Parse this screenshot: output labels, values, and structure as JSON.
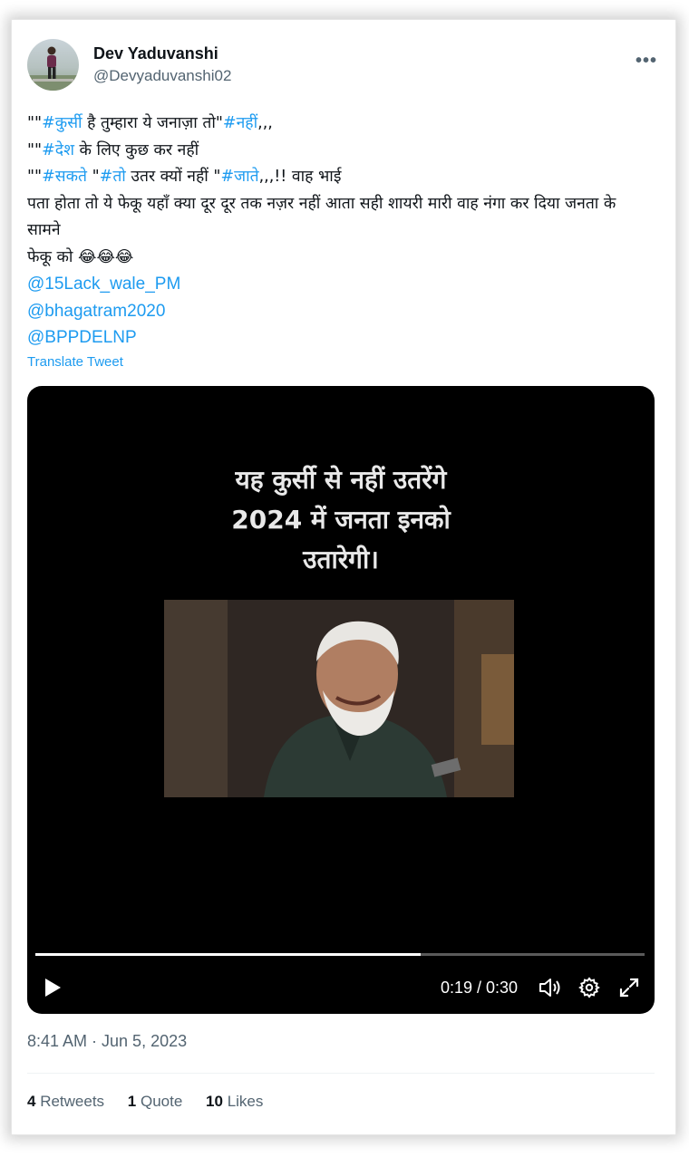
{
  "author": {
    "name": "Dev Yaduvanshi",
    "handle": "@Devyaduvanshi02"
  },
  "tweet": {
    "line1": {
      "q": "\"\"",
      "ht1": "#कुर्सी",
      "mid": " है तुम्हारा ये जनाज़ा तो\"",
      "ht2": "#नहीं",
      "end": ",,,"
    },
    "line2": {
      "q": "\"\"",
      "ht1": "#देश",
      "end": " के लिए कुछ कर नहीं"
    },
    "line3": {
      "q": "\"\"",
      "ht1": "#सकते",
      "mid": " \"",
      "ht2": "#तो",
      "mid2": " उतर क्यों नहीं \"",
      "ht3": "#जाते",
      "end": ",,,!! वाह भाई"
    },
    "line4": "पता होता तो ये फेकू यहाँ क्या दूर दूर तक नज़र नहीं आता सही शायरी मारी वाह नंगा कर दिया जनता के सामने",
    "line5": "फेकू को 😂😂😂",
    "mentions": [
      "@15Lack_wale_PM",
      "@bhagatram2020",
      "@BPPDELNP"
    ],
    "translate_label": "Translate Tweet"
  },
  "video": {
    "caption_lines": [
      "यह कुर्सी से नहीं उतरेंगे",
      "2024 में जनता इनको",
      "उतारेगी।"
    ],
    "time_display": "0:19 / 0:30",
    "progress_fraction": 0.633
  },
  "timestamp": "8:41 AM · Jun 5, 2023",
  "stats": [
    {
      "count": "4",
      "label": " Retweets"
    },
    {
      "count": "1",
      "label": " Quote"
    },
    {
      "count": "10",
      "label": " Likes"
    }
  ],
  "colors": {
    "link": "#1d9bf0",
    "muted": "#536471",
    "text": "#0f1419"
  }
}
